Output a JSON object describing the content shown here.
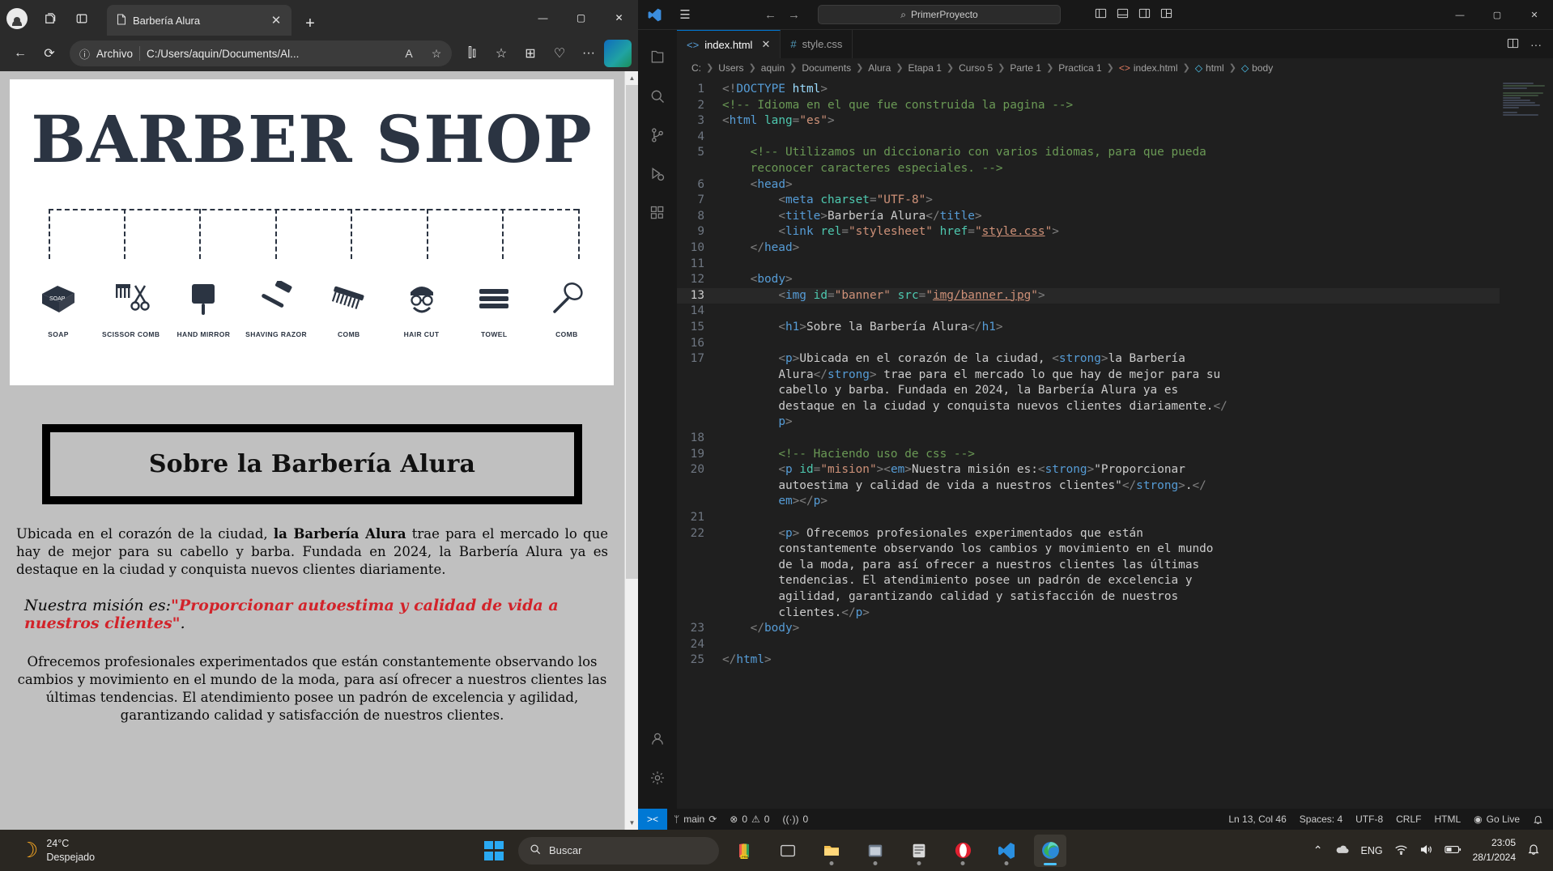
{
  "browser": {
    "tab": {
      "title": "Barbería Alura",
      "icon": "page-icon",
      "close": "✕"
    },
    "new_tab": "+",
    "window_controls": {
      "minimize": "—",
      "maximize": "▢",
      "close": "✕"
    },
    "toolbar": {
      "back": "←",
      "refresh": "⟳",
      "info_icon": "ⓘ",
      "scheme_label": "Archivo",
      "url": "C:/Users/aquin/Documents/Al...",
      "read_aloud": "A",
      "favorite": "☆",
      "split": "⫿⫾",
      "collections_fav": "☆",
      "collections": "⊞",
      "browser_essentials": "♡",
      "more": "···",
      "copilot": "C"
    },
    "titlebar_icons": {
      "profile": "avatar",
      "workspaces": "copy-icon",
      "tab_actions": "sidebar-icon"
    }
  },
  "page": {
    "banner": {
      "title": "BARBER SHOP",
      "tools": [
        {
          "glyph": "⬟",
          "caption": "SOAP"
        },
        {
          "glyph": "✂",
          "caption": "SCISSOR COMB"
        },
        {
          "glyph": "◗",
          "caption": "HAND MIRROR"
        },
        {
          "glyph": "⟋",
          "caption": "SHAVING RAZOR"
        },
        {
          "glyph": "▤",
          "caption": "COMB"
        },
        {
          "glyph": "☻",
          "caption": "HAIR CUT"
        },
        {
          "glyph": "▬",
          "caption": "TOWEL"
        },
        {
          "glyph": "⌗",
          "caption": "COMB"
        }
      ]
    },
    "h1": "Sobre la Barbería Alura",
    "p1_a": "Ubicada en el corazón de la ciudad, ",
    "p1_strong": "la Barbería Alura",
    "p1_b": " trae para el mercado lo que hay de mejor para su cabello y barba. Fundada en 2024, la Barbería Alura ya es destaque en la ciudad y conquista nuevos clientes diariamente.",
    "mision_a": "Nuestra misión es:",
    "mision_quote": "\"Proporcionar autoestima y calidad de vida a nuestros clientes\"",
    "mision_b": ".",
    "p3": "Ofrecemos profesionales experimentados que están constantemente observando los cambios y movimiento en el mundo de la moda, para así ofrecer a nuestros clientes las últimas tendencias. El atendimiento posee un padrón de excelencia y agilidad, garantizando calidad y satisfacción de nuestros clientes."
  },
  "vscode": {
    "titlebar": {
      "hamburger": "☰",
      "back": "←",
      "forward": "→",
      "search_icon": "⌕",
      "search_text": "PrimerProyecto",
      "layout_icons": [
        "panel-left-icon",
        "panel-bottom-icon",
        "panel-right-icon",
        "layout-grid-icon"
      ],
      "window_controls": {
        "minimize": "—",
        "maximize": "▢",
        "close": "✕"
      }
    },
    "activity_bar": [
      {
        "name": "explorer",
        "glyph": "⧉"
      },
      {
        "name": "search",
        "glyph": "⌕"
      },
      {
        "name": "source-control",
        "glyph": "ᛘ"
      },
      {
        "name": "run-and-debug",
        "glyph": "▷"
      },
      {
        "name": "extensions",
        "glyph": "⬚"
      },
      {
        "name": "accounts",
        "glyph": "☺"
      },
      {
        "name": "manage-settings",
        "glyph": "⚙"
      }
    ],
    "tabs": [
      {
        "label": "index.html",
        "icon": "<>",
        "active": true,
        "close": "✕"
      },
      {
        "label": "style.css",
        "icon": "#",
        "active": false,
        "close": ""
      }
    ],
    "tab_actions": {
      "split_editor": "⫿⫾",
      "more": "···"
    },
    "breadcrumb": [
      "C:",
      "Users",
      "aquin",
      "Documents",
      "Alura",
      "Etapa 1",
      "Curso 5",
      "Parte 1",
      "Practica 1",
      "index.html",
      "html",
      "body"
    ],
    "code_lines": [
      {
        "n": "1",
        "html": "<span class='s-punc'>&lt;!</span><span class='s-tag'>DOCTYPE</span> <span class='s-attr'>html</span><span class='s-punc'>&gt;</span>"
      },
      {
        "n": "2",
        "html": "<span class='s-com'>&lt;!-- Idioma en el que fue construida la pagina --&gt;</span>"
      },
      {
        "n": "3",
        "html": "<span class='s-punc'>&lt;</span><span class='s-tag'>html</span> <span class='s-name'>lang</span><span class='s-punc'>=</span><span class='s-str'>\"es\"</span><span class='s-punc'>&gt;</span>"
      },
      {
        "n": "4",
        "html": ""
      },
      {
        "n": "5",
        "html": "    <span class='s-com'>&lt;!-- Utilizamos un diccionario con varios idiomas, para que pueda</span>\n    <span class='s-com'>reconocer caracteres especiales. --&gt;</span>"
      },
      {
        "n": "6",
        "html": "    <span class='s-punc'>&lt;</span><span class='s-tag'>head</span><span class='s-punc'>&gt;</span>"
      },
      {
        "n": "7",
        "html": "        <span class='s-punc'>&lt;</span><span class='s-tag'>meta</span> <span class='s-name'>charset</span><span class='s-punc'>=</span><span class='s-str'>\"UTF-8\"</span><span class='s-punc'>&gt;</span>"
      },
      {
        "n": "8",
        "html": "        <span class='s-punc'>&lt;</span><span class='s-tag'>title</span><span class='s-punc'>&gt;</span><span class='s-txt'>Barbería Alura</span><span class='s-punc'>&lt;/</span><span class='s-tag'>title</span><span class='s-punc'>&gt;</span>"
      },
      {
        "n": "9",
        "html": "        <span class='s-punc'>&lt;</span><span class='s-tag'>link</span> <span class='s-name'>rel</span><span class='s-punc'>=</span><span class='s-str'>\"stylesheet\"</span> <span class='s-name'>href</span><span class='s-punc'>=</span><span class='s-str'>\"</span><span class='s-link'>style.css</span><span class='s-str'>\"</span><span class='s-punc'>&gt;</span>"
      },
      {
        "n": "10",
        "html": "    <span class='s-punc'>&lt;/</span><span class='s-tag'>head</span><span class='s-punc'>&gt;</span>"
      },
      {
        "n": "11",
        "html": ""
      },
      {
        "n": "12",
        "html": "    <span class='s-punc'>&lt;</span><span class='s-tag'>body</span><span class='s-punc'>&gt;</span>"
      },
      {
        "n": "13",
        "html": "        <span class='s-punc'>&lt;</span><span class='s-tag'>img</span> <span class='s-name'>id</span><span class='s-punc'>=</span><span class='s-str'>\"banner\"</span> <span class='s-name'>src</span><span class='s-punc'>=</span><span class='s-str'>\"</span><span class='s-link'>img/banner.jpg</span><span class='s-str'>\"</span><span class='s-punc'>&gt;</span>",
        "current": true
      },
      {
        "n": "14",
        "html": ""
      },
      {
        "n": "15",
        "html": "        <span class='s-punc'>&lt;</span><span class='s-tag'>h1</span><span class='s-punc'>&gt;</span><span class='s-txt'>Sobre la Barbería Alura</span><span class='s-punc'>&lt;/</span><span class='s-tag'>h1</span><span class='s-punc'>&gt;</span>"
      },
      {
        "n": "16",
        "html": ""
      },
      {
        "n": "17",
        "html": "        <span class='s-punc'>&lt;</span><span class='s-tag'>p</span><span class='s-punc'>&gt;</span><span class='s-txt'>Ubicada en el corazón de la ciudad, </span><span class='s-punc'>&lt;</span><span class='s-tag'>strong</span><span class='s-punc'>&gt;</span><span class='s-txt'>la Barbería\n        Alura</span><span class='s-punc'>&lt;/</span><span class='s-tag'>strong</span><span class='s-punc'>&gt;</span><span class='s-txt'> trae para el mercado lo que hay de mejor para su\n        cabello y barba. Fundada en 2024, la Barbería Alura ya es\n        destaque en la ciudad y conquista nuevos clientes diariamente.</span><span class='s-punc'>&lt;/\n        </span><span class='s-tag'>p</span><span class='s-punc'>&gt;</span>"
      },
      {
        "n": "18",
        "html": ""
      },
      {
        "n": "19",
        "html": "        <span class='s-com'>&lt;!-- Haciendo uso de css --&gt;</span>"
      },
      {
        "n": "20",
        "html": "        <span class='s-punc'>&lt;</span><span class='s-tag'>p</span> <span class='s-name'>id</span><span class='s-punc'>=</span><span class='s-str'>\"mision\"</span><span class='s-punc'>&gt;&lt;</span><span class='s-tag'>em</span><span class='s-punc'>&gt;</span><span class='s-txt'>Nuestra misión es:</span><span class='s-punc'>&lt;</span><span class='s-tag'>strong</span><span class='s-punc'>&gt;</span><span class='s-txt'>\"Proporcionar\n        autoestima y calidad de vida a nuestros clientes\"</span><span class='s-punc'>&lt;/</span><span class='s-tag'>strong</span><span class='s-punc'>&gt;</span><span class='s-txt'>.</span><span class='s-punc'>&lt;/\n        </span><span class='s-tag'>em</span><span class='s-punc'>&gt;&lt;/</span><span class='s-tag'>p</span><span class='s-punc'>&gt;</span>"
      },
      {
        "n": "21",
        "html": ""
      },
      {
        "n": "22",
        "html": "        <span class='s-punc'>&lt;</span><span class='s-tag'>p</span><span class='s-punc'>&gt;</span><span class='s-txt'> Ofrecemos profesionales experimentados que están\n        constantemente observando los cambios y movimiento en el mundo\n        de la moda, para así ofrecer a nuestros clientes las últimas\n        tendencias. El atendimiento posee un padrón de excelencia y\n        agilidad, garantizando calidad y satisfacción de nuestros\n        clientes.</span><span class='s-punc'>&lt;/</span><span class='s-tag'>p</span><span class='s-punc'>&gt;</span>"
      },
      {
        "n": "23",
        "html": "    <span class='s-punc'>&lt;/</span><span class='s-tag'>body</span><span class='s-punc'>&gt;</span>"
      },
      {
        "n": "24",
        "html": ""
      },
      {
        "n": "25",
        "html": "<span class='s-punc'>&lt;/</span><span class='s-tag'>html</span><span class='s-punc'>&gt;</span>"
      }
    ],
    "statusbar": {
      "remote": "><",
      "branch_icon": "ᛘ",
      "branch": "main",
      "sync": "⟳",
      "errors_icon": "⊗",
      "errors": "0",
      "warnings_icon": "⚠",
      "warnings": "0",
      "ports_icon": "((·))",
      "ports": "0",
      "cursor": "Ln 13, Col 46",
      "spaces": "Spaces: 4",
      "encoding": "UTF-8",
      "eol": "CRLF",
      "language": "HTML",
      "golive_icon": "◉",
      "golive": "Go Live",
      "bell": "🔔"
    }
  },
  "taskbar": {
    "weather": {
      "temp": "24°C",
      "condition": "Despejado",
      "icon": "moon-icon"
    },
    "search_placeholder": "Buscar",
    "apps": [
      {
        "name": "copilot",
        "glyph": "◈"
      },
      {
        "name": "file-explorer-taskview",
        "glyph": "▭"
      },
      {
        "name": "file-explorer",
        "glyph": "🗀"
      },
      {
        "name": "app-unknown",
        "glyph": "▤"
      },
      {
        "name": "notes",
        "glyph": "▥"
      },
      {
        "name": "opera",
        "glyph": "O"
      },
      {
        "name": "vscode",
        "glyph": "✖"
      },
      {
        "name": "edge",
        "glyph": "e"
      }
    ],
    "tray": {
      "chevron": "⌃",
      "onedrive": "☁",
      "language": "ENG",
      "wifi": "◗",
      "volume": "🔊",
      "battery": "▭"
    },
    "clock": {
      "time": "23:05",
      "date": "28/1/2024"
    }
  }
}
